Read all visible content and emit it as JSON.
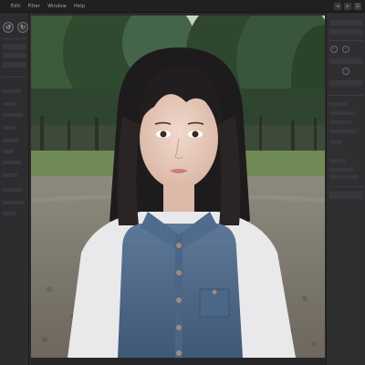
{
  "menu": {
    "items": [
      "Edit",
      "Filter",
      "Window",
      "Help"
    ]
  },
  "top_right_icons": [
    "◂",
    "▸",
    "☰"
  ],
  "left_panel": {
    "tools": [
      "↺",
      "↻"
    ]
  },
  "colors": {
    "menubar": "#202022",
    "panel": "#2d2d30",
    "accent": "#6f6f75"
  }
}
